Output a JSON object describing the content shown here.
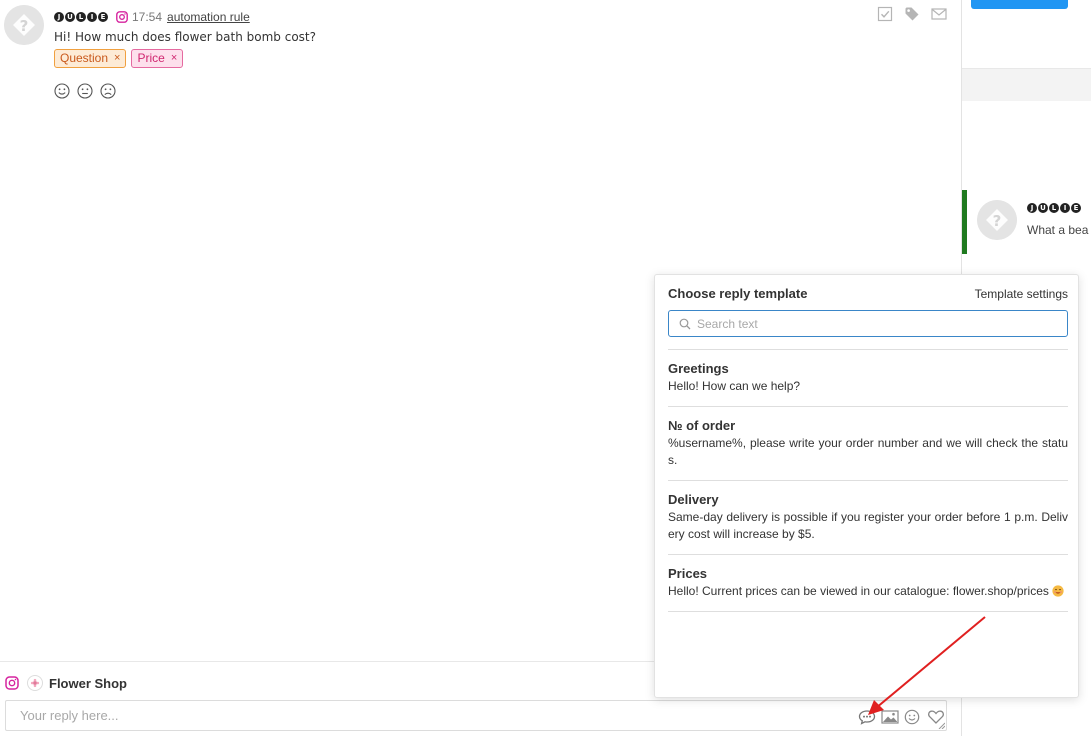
{
  "message": {
    "author_glyphs": [
      "J",
      "U",
      "L",
      "I",
      "E"
    ],
    "time": "17:54",
    "rule_link": "automation rule",
    "text": "Hi! How much does flower bath bomb cost?",
    "tags": [
      {
        "label": "Question",
        "remove": "×"
      },
      {
        "label": "Price",
        "remove": "×"
      }
    ],
    "reactions": [
      "smile-icon",
      "neutral-face-icon",
      "sad-face-icon"
    ],
    "actions": [
      "mark-done-icon",
      "tag-icon",
      "mail-icon"
    ]
  },
  "composer": {
    "channel_icon": "instagram-icon",
    "channel_name": "Flower Shop",
    "placeholder": "Your reply here...",
    "tools": [
      "reply-templates-icon",
      "image-icon",
      "emoji-icon",
      "heart-icon"
    ]
  },
  "right_panel": {
    "author_glyphs": [
      "J",
      "U",
      "L",
      "I",
      "E"
    ],
    "preview": "What a bea"
  },
  "template_popup": {
    "title": "Choose reply template",
    "settings_link": "Template settings",
    "search_placeholder": "Search text",
    "templates": [
      {
        "name": "Greetings",
        "text": "Hello! How can we help?"
      },
      {
        "name": "№ of order",
        "text": "%username%, please write your order number and we will check the status."
      },
      {
        "name": "Delivery",
        "text": "Same-day delivery is possible if you register your order before 1 p.m. Delivery cost will increase by $5."
      },
      {
        "name": "Prices",
        "text": "Hello! Current prices can be viewed in our catalogue: flower.shop/prices"
      }
    ]
  },
  "colors": {
    "accent_blue": "#2196f3",
    "search_border": "#3a86c8",
    "instagram": "#d6249f",
    "tag_question": "#f0a040",
    "tag_price": "#e56aa0",
    "active_bar": "#1f7a1f",
    "annotation_arrow": "#e02020"
  }
}
